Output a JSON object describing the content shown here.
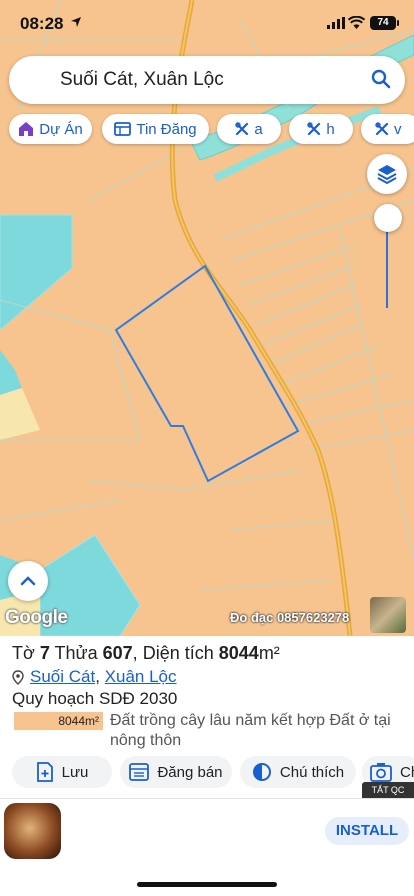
{
  "status_bar": {
    "time": "08:28",
    "battery": "74"
  },
  "search": {
    "value": "Suối Cát, Xuân Lộc"
  },
  "chips": [
    {
      "label": "Dự Án",
      "icon": "house-icon"
    },
    {
      "label": "Tin Đăng",
      "icon": "listing-icon"
    },
    {
      "label": "a",
      "icon": "tools-icon"
    },
    {
      "label": "h",
      "icon": "tools-icon"
    },
    {
      "label": "v",
      "icon": "tools-icon"
    }
  ],
  "map": {
    "attribution": "Google",
    "watermark": "Đo đạc 0857623278",
    "zoom_level": 0.1
  },
  "parcel": {
    "sheet_label": "Tờ",
    "sheet_no": "7",
    "parcel_label": "Thửa",
    "parcel_no": "607",
    "area_label": "Diện tích",
    "area_value": "8044",
    "area_unit": "m²",
    "commune": "Suối Cát",
    "district": "Xuân Lộc",
    "separator": ",",
    "plan_title": "Quy hoạch SDĐ 2030",
    "legend_value": "8044m²",
    "land_type": "Đất trồng cây lâu năm kết hợp Đất ở tại nông thôn"
  },
  "actions": [
    {
      "label": "Lưu",
      "icon": "save-icon"
    },
    {
      "label": "Đăng bán",
      "icon": "post-icon"
    },
    {
      "label": "Chú thích",
      "icon": "legend-icon"
    },
    {
      "label": "Ch",
      "icon": "camera-icon"
    }
  ],
  "ad": {
    "hide_label": "TẮT QC",
    "cta": "INSTALL"
  },
  "colors": {
    "accent": "#1a5fd0",
    "land": "#f7c48f",
    "water": "#7ed9dc",
    "boundary": "#2f7de0",
    "road": "#e8a835"
  }
}
